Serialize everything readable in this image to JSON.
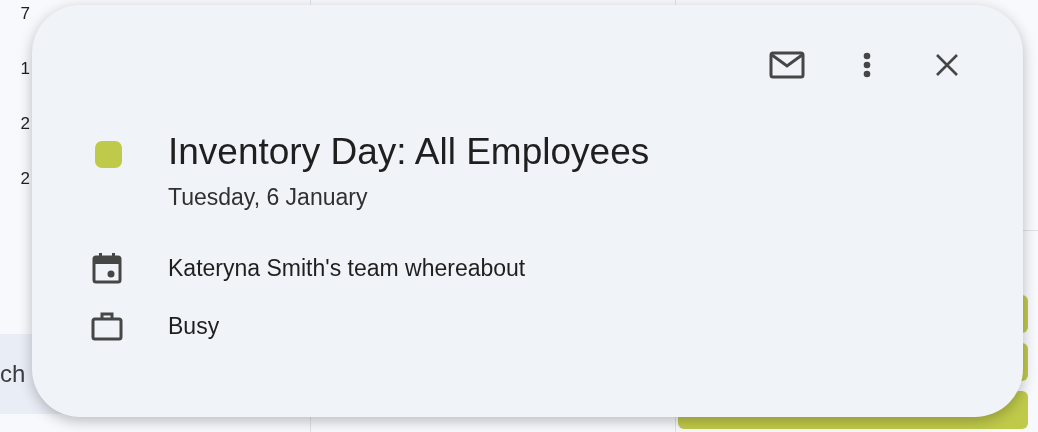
{
  "calendar": {
    "hour_labels": [
      "7",
      "1",
      "2",
      "2"
    ],
    "search": {
      "value": "ch"
    },
    "events": [
      {
        "color": "#c0ca4a"
      },
      {
        "color": "#c0ca4a"
      },
      {
        "color": "#c0ca4a"
      }
    ]
  },
  "event_popup": {
    "actions": [
      {
        "kind": "email"
      },
      {
        "kind": "more"
      },
      {
        "kind": "close"
      }
    ],
    "color": "#c0ca4a",
    "title": "Inventory Day: All Employees",
    "date": "Tuesday, 6 January",
    "details": [
      {
        "kind": "calendar",
        "text": "Kateryna Smith's team whereabout"
      },
      {
        "kind": "availability",
        "text": "Busy"
      }
    ]
  }
}
